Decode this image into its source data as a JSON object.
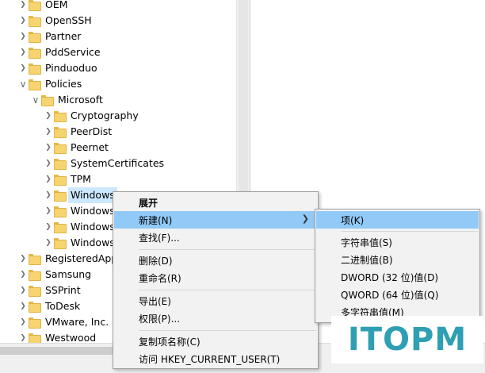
{
  "tree": {
    "items": [
      {
        "label": "OEM",
        "level": 0,
        "expanded": false
      },
      {
        "label": "OpenSSH",
        "level": 0,
        "expanded": false
      },
      {
        "label": "Partner",
        "level": 0,
        "expanded": false
      },
      {
        "label": "PddService",
        "level": 0,
        "expanded": false
      },
      {
        "label": "Pinduoduo",
        "level": 0,
        "expanded": false
      },
      {
        "label": "Policies",
        "level": 0,
        "expanded": true
      },
      {
        "label": "Microsoft",
        "level": 1,
        "expanded": true
      },
      {
        "label": "Cryptography",
        "level": 2,
        "expanded": false
      },
      {
        "label": "PeerDist",
        "level": 2,
        "expanded": false
      },
      {
        "label": "Peernet",
        "level": 2,
        "expanded": false
      },
      {
        "label": "SystemCertificates",
        "level": 2,
        "expanded": false
      },
      {
        "label": "TPM",
        "level": 2,
        "expanded": false
      },
      {
        "label": "Windows",
        "level": 2,
        "expanded": false,
        "selected": true
      },
      {
        "label": "Windows",
        "level": 2,
        "expanded": false
      },
      {
        "label": "Windows",
        "level": 2,
        "expanded": false
      },
      {
        "label": "Windows",
        "level": 2,
        "expanded": false
      },
      {
        "label": "RegisteredApp",
        "level": 0,
        "expanded": false
      },
      {
        "label": "Samsung",
        "level": 0,
        "expanded": false
      },
      {
        "label": "SSPrint",
        "level": 0,
        "expanded": false
      },
      {
        "label": "ToDesk",
        "level": 0,
        "expanded": false
      },
      {
        "label": "VMware, Inc.",
        "level": 0,
        "expanded": false
      },
      {
        "label": "Westwood",
        "level": 0,
        "expanded": false
      }
    ]
  },
  "context_menu": {
    "expand": "展开",
    "new": "新建(N)",
    "find": "查找(F)...",
    "delete": "删除(D)",
    "rename": "重命名(R)",
    "export": "导出(E)",
    "permissions": "权限(P)...",
    "copy_key_name": "复制项名称(C)",
    "visit": "访问 HKEY_CURRENT_USER(T)"
  },
  "submenu": {
    "key": "项(K)",
    "string_value": "字符串值(S)",
    "binary_value": "二进制值(B)",
    "dword_value": "DWORD (32 位)值(D)",
    "qword_value": "QWORD (64 位)值(Q)",
    "multi_string_value": "多字符串值(M)"
  },
  "watermark": {
    "text": "ITOPM",
    "color": "#2f9fb3"
  },
  "colors": {
    "selection": "#cce8ff",
    "menu_highlight": "#91c9f7",
    "folder": "#f6d46f"
  }
}
